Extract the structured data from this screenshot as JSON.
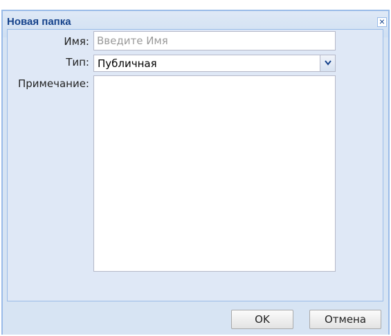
{
  "window": {
    "title": "Новая папка"
  },
  "form": {
    "name_label": "Имя:",
    "name_placeholder": "Введите Имя",
    "name_value": "",
    "type_label": "Тип:",
    "type_value": "Публичная",
    "note_label": "Примечание:",
    "note_value": ""
  },
  "buttons": {
    "ok": "OK",
    "cancel": "Отмена"
  },
  "icons": {
    "close": "close-icon",
    "dropdown": "chevron-down-icon"
  },
  "colors": {
    "title": "#15428b",
    "border": "#99bbe8",
    "panel": "#dfe8f6"
  }
}
